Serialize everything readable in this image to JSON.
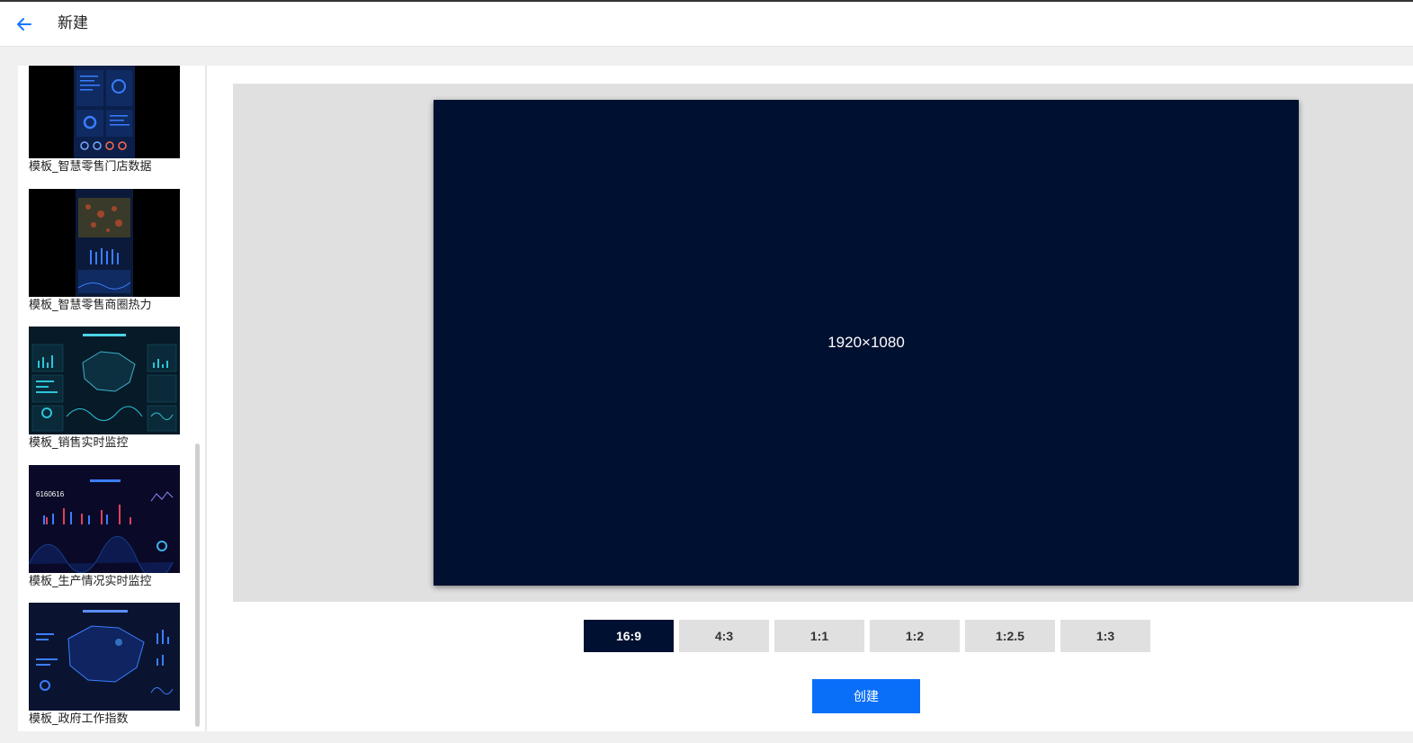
{
  "header": {
    "title": "新建",
    "back_icon": "arrow-left-icon",
    "accent": "#1677ff"
  },
  "sidebar": {
    "templates": [
      {
        "label": "模板_智慧零售门店数据"
      },
      {
        "label": "模板_智慧零售商圈热力"
      },
      {
        "label": "模板_销售实时监控"
      },
      {
        "label": "模板_生产情况实时监控",
        "thumb_text": "6160616"
      },
      {
        "label": "模板_政府工作指数"
      }
    ]
  },
  "preview": {
    "size_label": "1920×1080",
    "background": "#001030"
  },
  "ratios": [
    {
      "label": "16:9",
      "active": true
    },
    {
      "label": "4:3",
      "active": false
    },
    {
      "label": "1:1",
      "active": false
    },
    {
      "label": "1:2",
      "active": false
    },
    {
      "label": "1:2.5",
      "active": false
    },
    {
      "label": "1:3",
      "active": false
    }
  ],
  "create_button": {
    "label": "创建",
    "color": "#0a6ff8"
  }
}
